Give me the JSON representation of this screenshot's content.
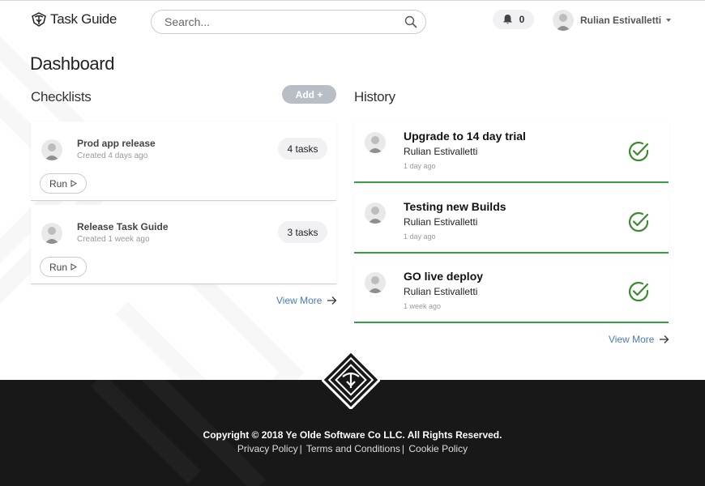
{
  "header": {
    "app_name": "Task Guide",
    "search_placeholder": "Search...",
    "notification_count": "0",
    "user_name": "Rulian Estivalletti"
  },
  "page_title": "Dashboard",
  "checklists": {
    "title": "Checklists",
    "add_label": "Add +",
    "items": [
      {
        "title": "Prod app release",
        "created": "Created 4 days ago",
        "tasks": "4 tasks",
        "run_label": "Run"
      },
      {
        "title": "Release Task Guide",
        "created": "Created 1 week ago",
        "tasks": "3 tasks",
        "run_label": "Run"
      }
    ],
    "view_more": "View More"
  },
  "history": {
    "title": "History",
    "items": [
      {
        "title": "Upgrade to 14 day trial",
        "user": "Rulian Estivalletti",
        "time": "1 day ago"
      },
      {
        "title": "Testing new Builds",
        "user": "Rulian Estivalletti",
        "time": "1 day ago"
      },
      {
        "title": "GO live deploy",
        "user": "Rulian Estivalletti",
        "time": "1 week ago"
      }
    ],
    "view_more": "View More"
  },
  "footer": {
    "copyright": "Copyright © 2018 Ye Olde Software Co LLC. All Rights Reserved.",
    "links": [
      "Privacy Policy",
      "Terms and Conditions",
      "Cookie Policy"
    ]
  },
  "colors": {
    "accent_link": "#4a79b8",
    "success_green": "#3a9a4c",
    "footer_bg": "#181818"
  },
  "icons": [
    "logo-icon",
    "search-icon",
    "bell-icon",
    "avatar",
    "play-icon",
    "check-circle-icon",
    "arrow-right-icon"
  ]
}
